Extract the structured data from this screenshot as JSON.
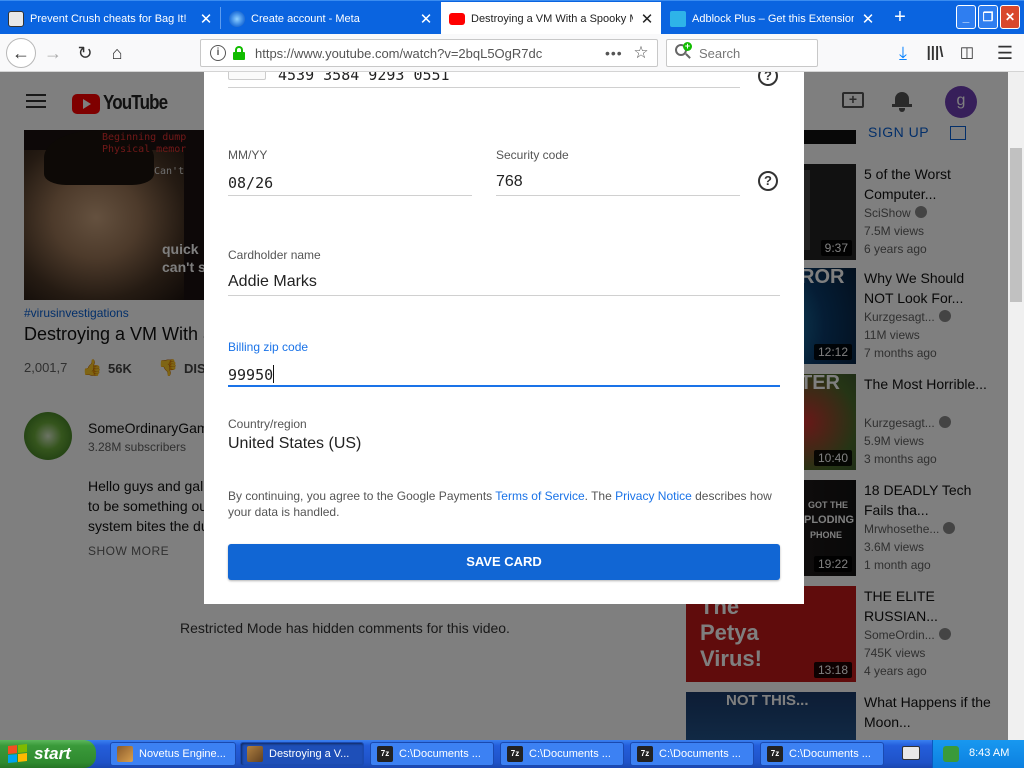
{
  "browser": {
    "tabs": [
      {
        "title": "Prevent Crush cheats for Bag It!",
        "active": false
      },
      {
        "title": "Create account - Meta",
        "active": false
      },
      {
        "title": "Destroying a VM With a Spooky M",
        "active": true
      },
      {
        "title": "Adblock Plus – Get this Extension",
        "active": false
      }
    ],
    "new_tab_label": "+",
    "url": "https://www.youtube.com/watch?v=2bqL5OgR7dc",
    "search_placeholder": "Search",
    "window_controls": {
      "minimize": "_",
      "maximize": "❐",
      "close": "✕"
    }
  },
  "youtube": {
    "logo_text": "YouTube",
    "avatar_letter": "g",
    "sign_up": "SIGN UP",
    "video": {
      "hashtag": "#virusinvestigations",
      "title": "Destroying a VM With a",
      "views": "2,001,7",
      "likes": "56K",
      "dislike_label": "DIS",
      "overlay_lines": [
        "Beginning dump",
        "Physical memor",
        "Can't",
        "quick",
        "can't s"
      ]
    },
    "channel": {
      "name": "SomeOrdinaryGam",
      "subscribers": "3.28M subscribers",
      "description_lines": [
        "Hello guys and gal",
        "to be something ou",
        "system bites the du"
      ],
      "show_more": "SHOW MORE"
    },
    "restricted_notice": "Restricted Mode has hidden comments for this video.",
    "recommendations": [
      {
        "title": "5 of the Worst Computer...",
        "channel": "SciShow",
        "views": "7.5M views",
        "age": "6 years ago",
        "duration": "9:37"
      },
      {
        "title": "Why We Should NOT Look For...",
        "channel": "Kurzgesagt...",
        "views": "11M views",
        "age": "7 months ago",
        "duration": "12:12"
      },
      {
        "title": "The Most Horrible...",
        "channel": "Kurzgesagt...",
        "views": "5.9M views",
        "age": "3 months ago",
        "duration": "10:40"
      },
      {
        "title": "18 DEADLY Tech Fails tha...",
        "channel": "Mrwhosethe...",
        "views": "3.6M views",
        "age": "1 month ago",
        "duration": "19:22"
      },
      {
        "title": "THE ELITE RUSSIAN...",
        "channel": "SomeOrdin...",
        "views": "745K views",
        "age": "4 years ago",
        "duration": "13:18"
      },
      {
        "title": "What Happens if the Moon...",
        "channel": "",
        "views": "",
        "age": "",
        "duration": ""
      }
    ],
    "thumb_texts": {
      "t2": "ROR",
      "t3": "TER",
      "t4a": "GOT THE",
      "t4b": "PLODING",
      "t4c": "PHONE",
      "t5a": "The",
      "t5b": "Petya",
      "t5c": "Virus!",
      "t6": "NOT THIS..."
    }
  },
  "dialog": {
    "card_number": "4539 3584 9293 0551",
    "exp_label": "MM/YY",
    "exp_value": "08/26",
    "security_label": "Security code",
    "security_value": "768",
    "cardholder_label": "Cardholder name",
    "cardholder_value": "Addie Marks",
    "zip_label": "Billing zip code",
    "zip_value": "99950",
    "country_label": "Country/region",
    "country_value": "United States (US)",
    "legal_prefix": "By continuing, you agree to the Google Payments ",
    "terms_link": "Terms of Service",
    "legal_middle": ". The ",
    "privacy_link": "Privacy Notice",
    "legal_suffix": " describes how your data is handled.",
    "save_button": "SAVE CARD",
    "help_symbol": "?"
  },
  "taskbar": {
    "start_label": "start",
    "tasks": [
      {
        "label": "Novetus Engine..."
      },
      {
        "label": "Destroying a V..."
      },
      {
        "label": "C:\\Documents ..."
      },
      {
        "label": "C:\\Documents ..."
      },
      {
        "label": "C:\\Documents ..."
      },
      {
        "label": "C:\\Documents ..."
      }
    ],
    "zip_icon_text": "7z",
    "clock": "8:43 AM"
  },
  "colors": {
    "tabstrip": "#0a64e0",
    "accent": "#1a73e8",
    "save_button": "#1166d4",
    "youtube_red": "#ff0000"
  }
}
